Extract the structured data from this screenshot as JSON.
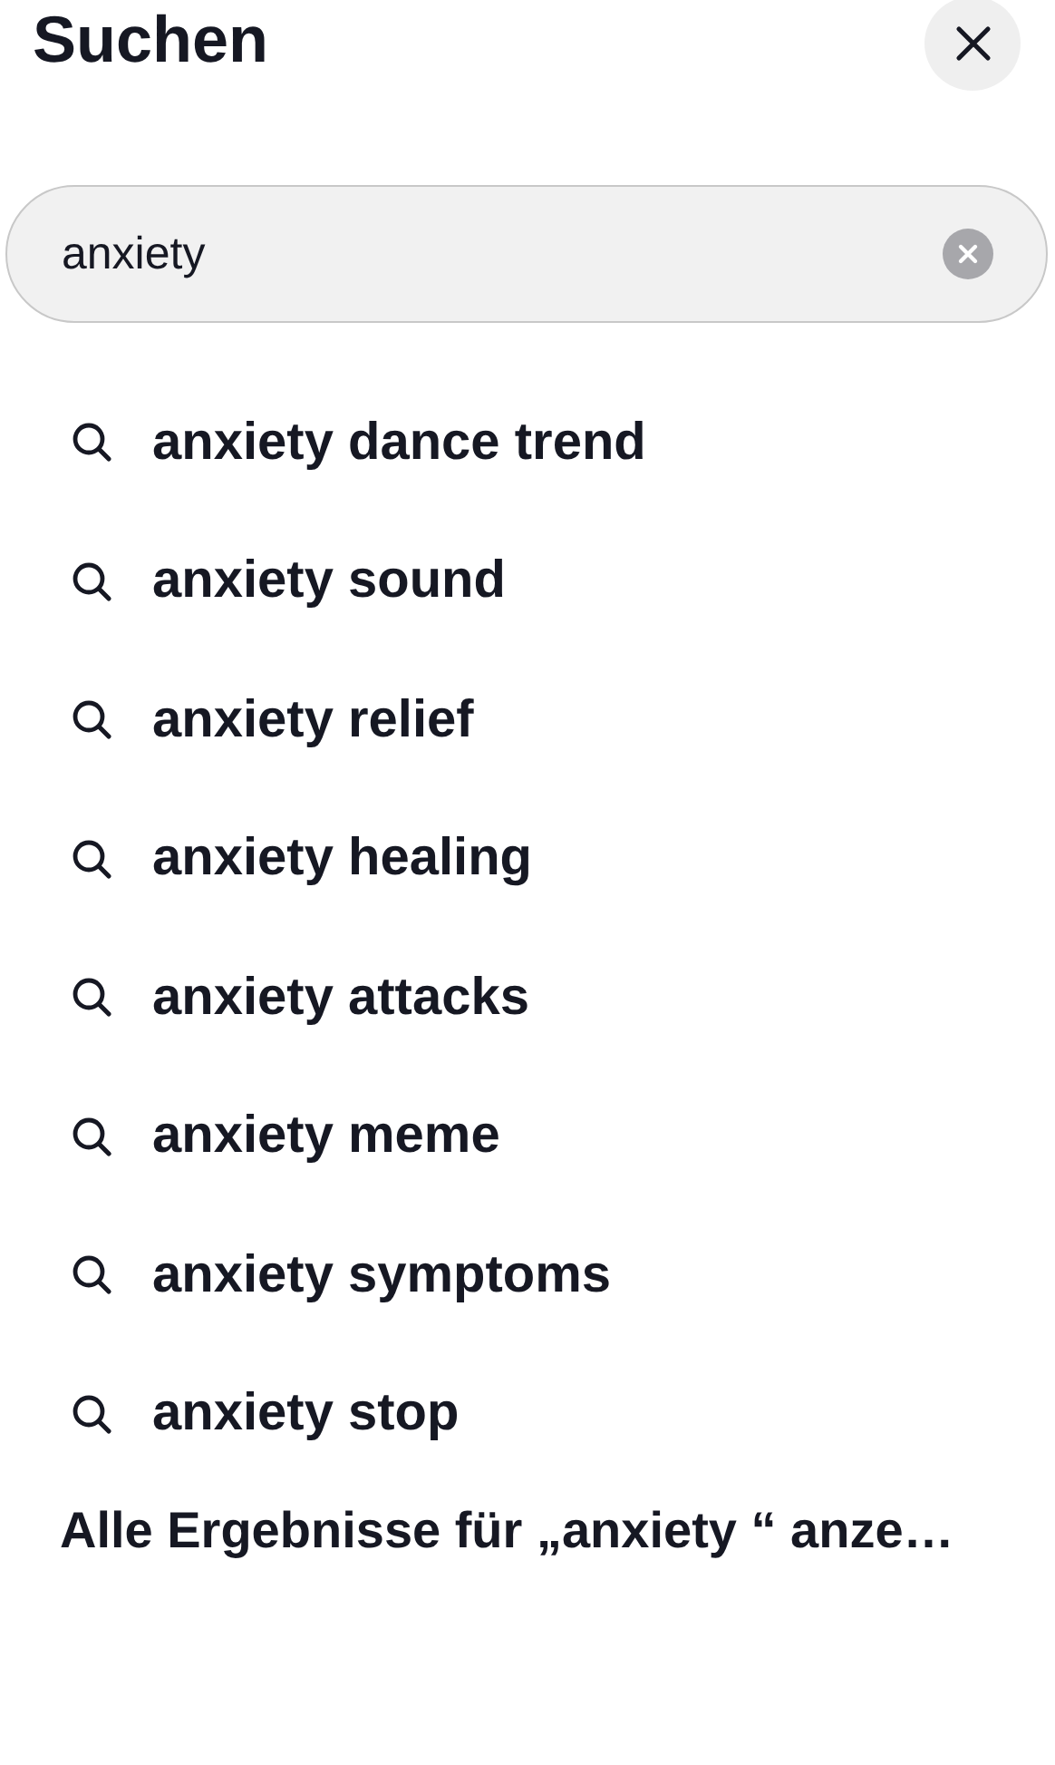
{
  "header": {
    "title": "Suchen"
  },
  "search": {
    "value": "anxiety"
  },
  "suggestions": [
    {
      "label": "anxiety dance trend"
    },
    {
      "label": "anxiety sound"
    },
    {
      "label": "anxiety relief"
    },
    {
      "label": "anxiety healing"
    },
    {
      "label": "anxiety attacks"
    },
    {
      "label": "anxiety meme"
    },
    {
      "label": "anxiety symptoms"
    },
    {
      "label": "anxiety stop"
    }
  ],
  "all_results_link": "Alle Ergebnisse für „anxiety “ anze…"
}
